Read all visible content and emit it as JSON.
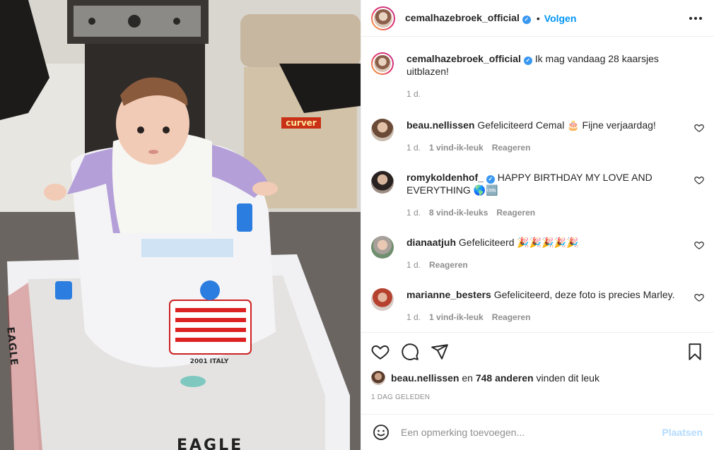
{
  "post": {
    "photo": {
      "sticker_text": "curver",
      "plate_text": "2001 ITALY",
      "side_text": "EAGLE",
      "front_text": "EAGLE"
    },
    "author": {
      "username": "cemalhazebroek_official",
      "verified": true,
      "follow_label": "Volgen"
    },
    "caption": {
      "username": "cemalhazebroek_official",
      "text": "Ik mag vandaag 28 kaarsjes uitblazen!",
      "time": "1 d."
    },
    "comments": [
      {
        "username": "beau.nellissen",
        "verified": false,
        "text": "Gefeliciteerd Cemal 🎂 Fijne verjaardag!",
        "time": "1 d.",
        "likes": "1 vind-ik-leuk",
        "reply_label": "Reageren"
      },
      {
        "username": "romykoldenhof_",
        "verified": true,
        "text": "HAPPY BIRTHDAY MY LOVE AND EVERYTHING 🌎🆒",
        "time": "1 d.",
        "likes": "8 vind-ik-leuks",
        "reply_label": "Reageren"
      },
      {
        "username": "dianaatjuh",
        "verified": false,
        "text": "Gefeliciteerd 🎉🎉🎉🎉🎉",
        "time": "1 d.",
        "likes": "",
        "reply_label": "Reageren"
      },
      {
        "username": "marianne_besters",
        "verified": false,
        "text": "Gefeliciteerd, deze foto is precies Marley.",
        "time": "1 d.",
        "likes": "1 vind-ik-leuk",
        "reply_label": "Reageren"
      }
    ],
    "likes_summary": {
      "first_user": "beau.nellissen",
      "connector": " en ",
      "others": "748 anderen",
      "suffix": " vinden dit leuk"
    },
    "date_label": "1 DAG GELEDEN",
    "composer": {
      "placeholder": "Een opmerking toevoegen...",
      "post_label": "Plaatsen"
    }
  },
  "icons": {
    "more": "more-horizontal-icon",
    "like": "heart-outline-icon",
    "comment": "speech-bubble-icon",
    "share": "paper-plane-icon",
    "save": "bookmark-icon",
    "emoji": "smiley-icon"
  },
  "colors": {
    "accent": "#0095f6",
    "post_disabled": "#b3dbff",
    "verified": "#3897f0",
    "muted": "#8e8e8e"
  }
}
